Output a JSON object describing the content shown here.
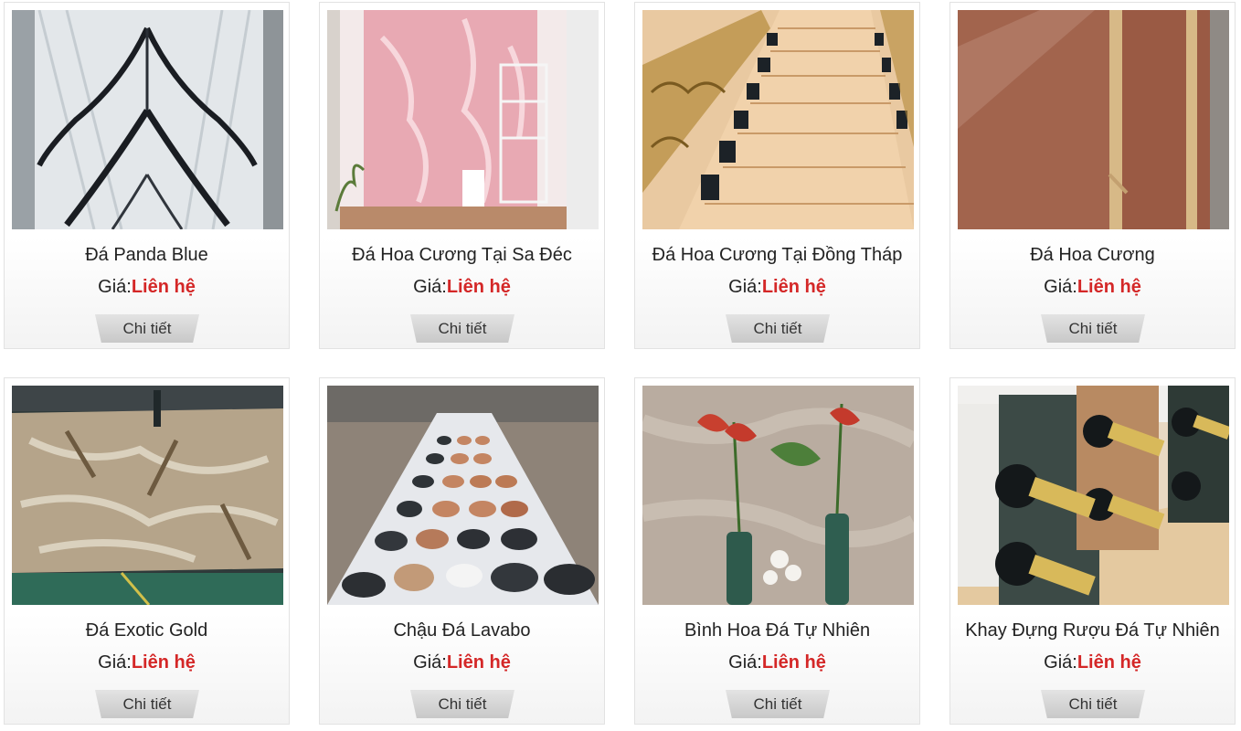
{
  "products": [
    {
      "name": "Đá Panda Blue",
      "price_label": "Giá:",
      "price_value": "Liên hệ",
      "button_label": "Chi tiết",
      "image": "panda-blue-marble-slab"
    },
    {
      "name": "Đá Hoa Cương Tại Sa Đéc",
      "price_label": "Giá:",
      "price_value": "Liên hệ",
      "button_label": "Chi tiết",
      "image": "pink-onyx-wall"
    },
    {
      "name": "Đá Hoa Cương Tại Đồng Tháp",
      "price_label": "Giá:",
      "price_value": "Liên hệ",
      "button_label": "Chi tiết",
      "image": "marble-staircase"
    },
    {
      "name": "Đá Hoa Cương",
      "price_label": "Giá:",
      "price_value": "Liên hệ",
      "button_label": "Chi tiết",
      "image": "red-granite-slab"
    },
    {
      "name": "Đá Exotic Gold",
      "price_label": "Giá:",
      "price_value": "Liên hệ",
      "button_label": "Chi tiết",
      "image": "exotic-gold-granite-slab"
    },
    {
      "name": "Chậu Đá Lavabo",
      "price_label": "Giá:",
      "price_value": "Liên hệ",
      "button_label": "Chi tiết",
      "image": "stone-basins-rows"
    },
    {
      "name": "Bình Hoa Đá Tự Nhiên",
      "price_label": "Giá:",
      "price_value": "Liên hệ",
      "button_label": "Chi tiết",
      "image": "stone-vases-with-flowers"
    },
    {
      "name": "Khay Đựng Rượu Đá Tự Nhiên",
      "price_label": "Giá:",
      "price_value": "Liên hệ",
      "button_label": "Chi tiết",
      "image": "stone-wine-racks"
    }
  ]
}
